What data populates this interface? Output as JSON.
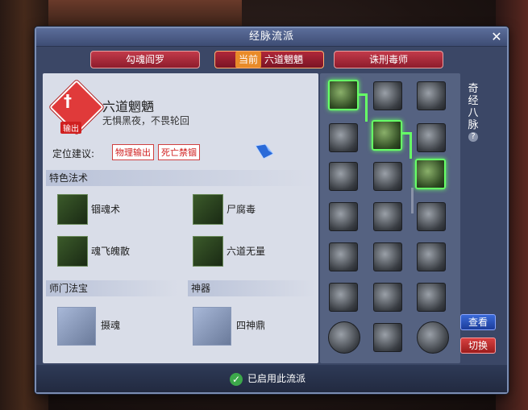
{
  "window": {
    "title": "经脉流派",
    "close_symbol": "✕"
  },
  "tabs": [
    {
      "label": "勾魂阎罗",
      "active": false
    },
    {
      "prefix": "当前",
      "label": "六道魍魉",
      "active": true
    },
    {
      "label": "诛刑毒师",
      "active": false
    }
  ],
  "school": {
    "name": "六道魍魉",
    "motto": "无惧黑夜，不畏轮回",
    "tag": "输出",
    "icon": "sword-icon",
    "position_label": "定位建议:",
    "badges": [
      "物理输出",
      "死亡禁锢"
    ]
  },
  "sections": {
    "special_skills": "特色法术",
    "sect_treasure": "师门法宝",
    "artifact": "神器"
  },
  "skills": [
    {
      "label": "锢魂术",
      "icon": "ghost-icon"
    },
    {
      "label": "尸腐毒",
      "icon": "skull-icon"
    },
    {
      "label": "魂飞魄散",
      "icon": "spirits-icon"
    },
    {
      "label": "六道无量",
      "icon": "vortex-icon"
    }
  ],
  "treasure": {
    "label": "摄魂",
    "icon": "banner-icon"
  },
  "artifact": {
    "label": "四神鼎",
    "icon": "cauldron-icon"
  },
  "meridian": {
    "side_title": "奇经八脉",
    "help_symbol": "?",
    "view_button": "查看",
    "switch_button": "切换"
  },
  "footer": {
    "check_symbol": "✓",
    "status": "已启用此流派"
  },
  "accent_colors": {
    "active_node": "#66ff66",
    "tab_red": "#b0283a",
    "badge_red": "#d02020"
  }
}
